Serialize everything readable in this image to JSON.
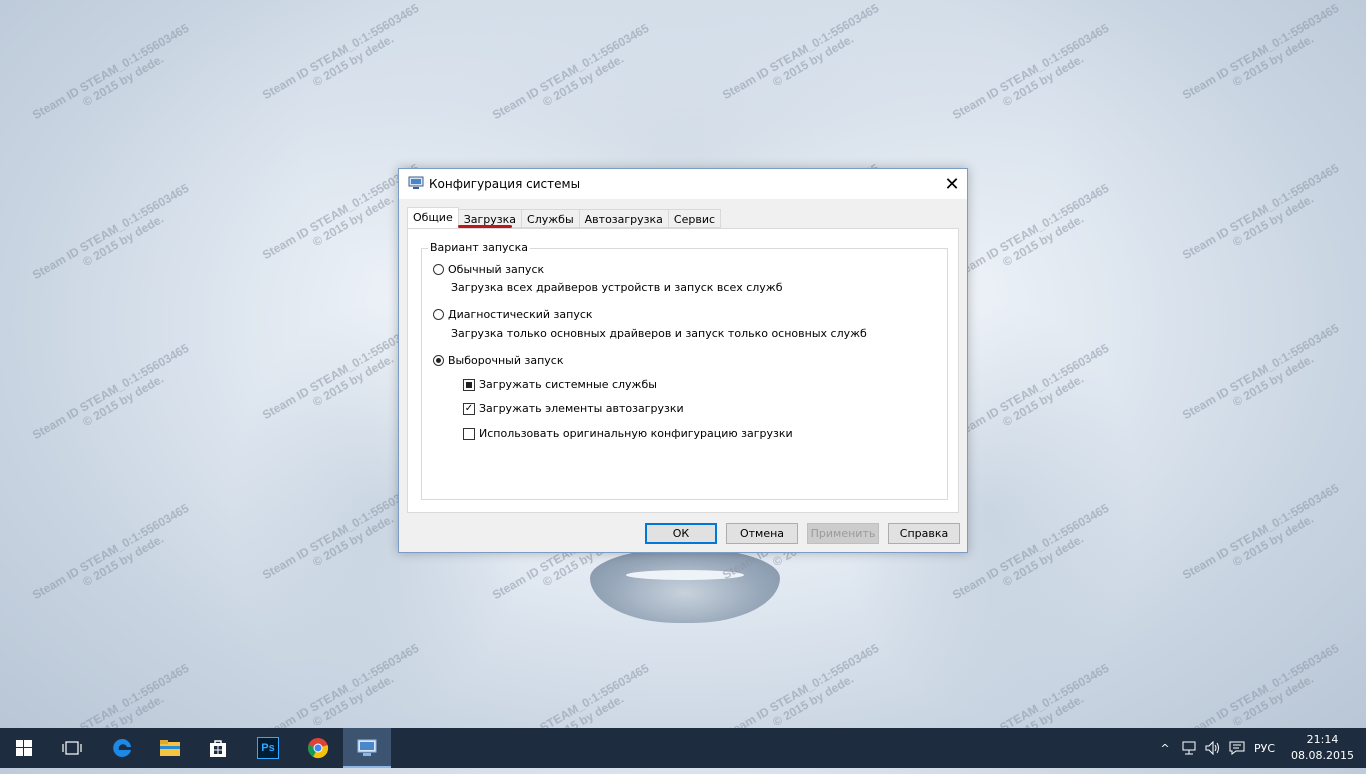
{
  "watermark": {
    "line1": "Steam ID  STEAM_0:1:55603465",
    "line2": "© 2015 by dede."
  },
  "dialog": {
    "title": "Конфигурация системы",
    "close_glyph": "✕",
    "tabs": [
      {
        "label": "Общие",
        "active": true
      },
      {
        "label": "Загрузка",
        "active": false
      },
      {
        "label": "Службы",
        "active": false
      },
      {
        "label": "Автозагрузка",
        "active": false
      },
      {
        "label": "Сервис",
        "active": false
      }
    ],
    "group_title": "Вариант запуска",
    "options": {
      "normal": {
        "label": "Обычный запуск",
        "desc": "Загрузка всех драйверов устройств и запуск всех служб",
        "checked": false
      },
      "diagnostic": {
        "label": "Диагностический запуск",
        "desc": "Загрузка только основных драйверов и запуск только основных служб",
        "checked": false
      },
      "selective": {
        "label": "Выборочный запуск",
        "checked": true
      }
    },
    "checkboxes": {
      "system_services": {
        "label": "Загружать системные службы",
        "state": "indeterminate"
      },
      "startup_items": {
        "label": "Загружать элементы автозагрузки",
        "state": "checked",
        "glyph": "✓"
      },
      "original_config": {
        "label": "Использовать оригинальную конфигурацию загрузки",
        "state": "unchecked"
      }
    },
    "buttons": {
      "ok": "ОК",
      "cancel": "Отмена",
      "apply": "Применить",
      "help": "Справка"
    }
  },
  "taskbar": {
    "icons": [
      "windows-start-icon",
      "task-view-icon",
      "edge-icon",
      "file-explorer-icon",
      "store-icon",
      "photoshop-icon",
      "chrome-icon",
      "msconfig-icon"
    ],
    "photoshop_label": "Ps",
    "tray": {
      "chevron": "^",
      "language": "РУС"
    },
    "time": "21:14",
    "date": "08.08.2015"
  },
  "colors": {
    "taskbar_bg": "#1d2d3f",
    "accent": "#0078d7",
    "annotation_red": "#c0151a"
  }
}
